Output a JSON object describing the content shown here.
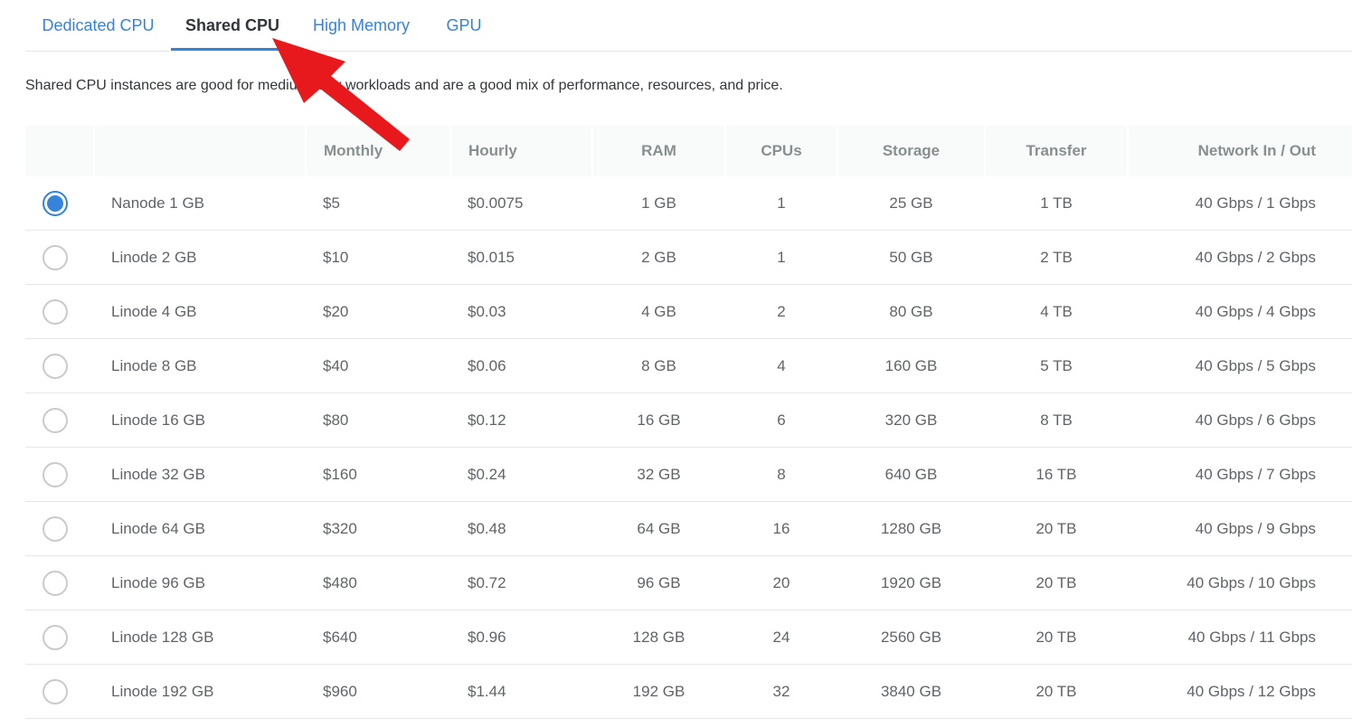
{
  "tabs": [
    {
      "label": "Dedicated CPU",
      "active": false
    },
    {
      "label": "Shared CPU",
      "active": true
    },
    {
      "label": "High Memory",
      "active": false
    },
    {
      "label": "GPU",
      "active": false
    }
  ],
  "description": "Shared CPU instances are good for medium-duty workloads and are a good mix of performance, resources, and price.",
  "table": {
    "headers": [
      "",
      "",
      "Monthly",
      "Hourly",
      "RAM",
      "CPUs",
      "Storage",
      "Transfer",
      "Network In / Out"
    ],
    "rows": [
      {
        "name": "Nanode 1 GB",
        "monthly": "$5",
        "hourly": "$0.0075",
        "ram": "1 GB",
        "cpus": "1",
        "storage": "25 GB",
        "transfer": "1 TB",
        "network": "40 Gbps / 1 Gbps",
        "selected": true
      },
      {
        "name": "Linode 2 GB",
        "monthly": "$10",
        "hourly": "$0.015",
        "ram": "2 GB",
        "cpus": "1",
        "storage": "50 GB",
        "transfer": "2 TB",
        "network": "40 Gbps / 2 Gbps",
        "selected": false
      },
      {
        "name": "Linode 4 GB",
        "monthly": "$20",
        "hourly": "$0.03",
        "ram": "4 GB",
        "cpus": "2",
        "storage": "80 GB",
        "transfer": "4 TB",
        "network": "40 Gbps / 4 Gbps",
        "selected": false
      },
      {
        "name": "Linode 8 GB",
        "monthly": "$40",
        "hourly": "$0.06",
        "ram": "8 GB",
        "cpus": "4",
        "storage": "160 GB",
        "transfer": "5 TB",
        "network": "40 Gbps / 5 Gbps",
        "selected": false
      },
      {
        "name": "Linode 16 GB",
        "monthly": "$80",
        "hourly": "$0.12",
        "ram": "16 GB",
        "cpus": "6",
        "storage": "320 GB",
        "transfer": "8 TB",
        "network": "40 Gbps / 6 Gbps",
        "selected": false
      },
      {
        "name": "Linode 32 GB",
        "monthly": "$160",
        "hourly": "$0.24",
        "ram": "32 GB",
        "cpus": "8",
        "storage": "640 GB",
        "transfer": "16 TB",
        "network": "40 Gbps / 7 Gbps",
        "selected": false
      },
      {
        "name": "Linode 64 GB",
        "monthly": "$320",
        "hourly": "$0.48",
        "ram": "64 GB",
        "cpus": "16",
        "storage": "1280 GB",
        "transfer": "20 TB",
        "network": "40 Gbps / 9 Gbps",
        "selected": false
      },
      {
        "name": "Linode 96 GB",
        "monthly": "$480",
        "hourly": "$0.72",
        "ram": "96 GB",
        "cpus": "20",
        "storage": "1920 GB",
        "transfer": "20 TB",
        "network": "40 Gbps / 10 Gbps",
        "selected": false
      },
      {
        "name": "Linode 128 GB",
        "monthly": "$640",
        "hourly": "$0.96",
        "ram": "128 GB",
        "cpus": "24",
        "storage": "2560 GB",
        "transfer": "20 TB",
        "network": "40 Gbps / 11 Gbps",
        "selected": false
      },
      {
        "name": "Linode 192 GB",
        "monthly": "$960",
        "hourly": "$1.44",
        "ram": "192 GB",
        "cpus": "32",
        "storage": "3840 GB",
        "transfer": "20 TB",
        "network": "40 Gbps / 12 Gbps",
        "selected": false
      }
    ]
  },
  "colors": {
    "accent": "#3683dc",
    "annotation_arrow": "#e8191c"
  },
  "annotation": {
    "icon": "red-arrow-icon"
  }
}
